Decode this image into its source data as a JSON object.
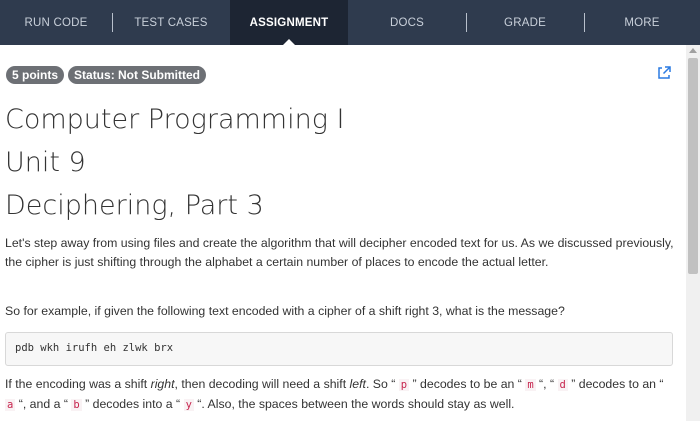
{
  "nav": {
    "tabs": [
      {
        "label": "RUN CODE"
      },
      {
        "label": "TEST CASES"
      },
      {
        "label": "ASSIGNMENT"
      },
      {
        "label": "DOCS"
      },
      {
        "label": "GRADE"
      },
      {
        "label": "MORE"
      }
    ],
    "active_tab": "ASSIGNMENT"
  },
  "badges": {
    "points": "5 points",
    "status": "Status: Not Submitted"
  },
  "headings": {
    "course": "Computer Programming I",
    "unit": "Unit 9",
    "lesson": "Deciphering, Part 3"
  },
  "body": {
    "intro": "Let's step away from using files and create the algorithm that will decipher encoded text for us. As we discussed previously, the cipher is just shifting through the alphabet a certain number of places to encode the actual letter.",
    "example_question": "So for example, if given the following text encoded with a cipher of a shift right 3, what is the message?",
    "encoded_text": "pdb wkh irufh eh zlwk brx",
    "explanation": {
      "t1": "If the encoding was a shift ",
      "right": "right",
      "t2": ", then decoding will need a shift ",
      "left": "left",
      "t3": ". So “ ",
      "c1": "p",
      "t4": " ” decodes to be an “ ",
      "c2": "m",
      "t5": " “, “ ",
      "c3": "d",
      "t6": " ” decodes to an “ ",
      "c4": "a",
      "t7": " “, and a “ ",
      "c5": "b",
      "t8": " ” decodes into a “ ",
      "c6": "y",
      "t9": " “. Also, the spaces between the words should stay as well."
    }
  },
  "colors": {
    "nav_bg": "#2f3b4e",
    "nav_active_bg": "#1d2533",
    "badge_bg": "#6d7075",
    "link_blue": "#2a7ae2",
    "inline_code": "#c7254e"
  },
  "icons": {
    "external_link": "external-link-icon"
  }
}
